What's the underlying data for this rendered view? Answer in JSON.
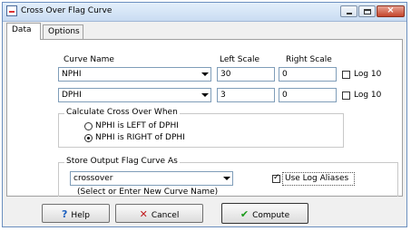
{
  "window": {
    "title": "Cross Over Flag Curve"
  },
  "tabs": [
    {
      "label": "Data"
    },
    {
      "label": "Options"
    }
  ],
  "headers": {
    "curve_name": "Curve Name",
    "left_scale": "Left Scale",
    "right_scale": "Right Scale"
  },
  "rows": [
    {
      "curve": "NPHI",
      "left": "30",
      "right": "0",
      "log_label": "Log 10",
      "log_checked": false
    },
    {
      "curve": "DPHI",
      "left": "3",
      "right": "0",
      "log_label": "Log 10",
      "log_checked": false
    }
  ],
  "crossover": {
    "title": "Calculate Cross Over When",
    "options": [
      {
        "label": "NPHI is LEFT of DPHI",
        "selected": false
      },
      {
        "label": "NPHI is RIGHT of DPHI",
        "selected": true
      }
    ]
  },
  "store": {
    "title": "Store Output Flag Curve As",
    "value": "crossover",
    "hint": "(Select or Enter New Curve Name)",
    "aliases_label": "Use Log Aliases",
    "aliases_checked": true
  },
  "buttons": {
    "help": "Help",
    "cancel": "Cancel",
    "compute": "Compute"
  },
  "icons": {
    "help": "help-question-icon",
    "cancel": "cancel-x-icon",
    "compute": "checkmark-icon"
  },
  "colors": {
    "help_icon": "#1b5fbf",
    "cancel_icon": "#c0181c",
    "compute_icon": "#1a9a1a"
  }
}
